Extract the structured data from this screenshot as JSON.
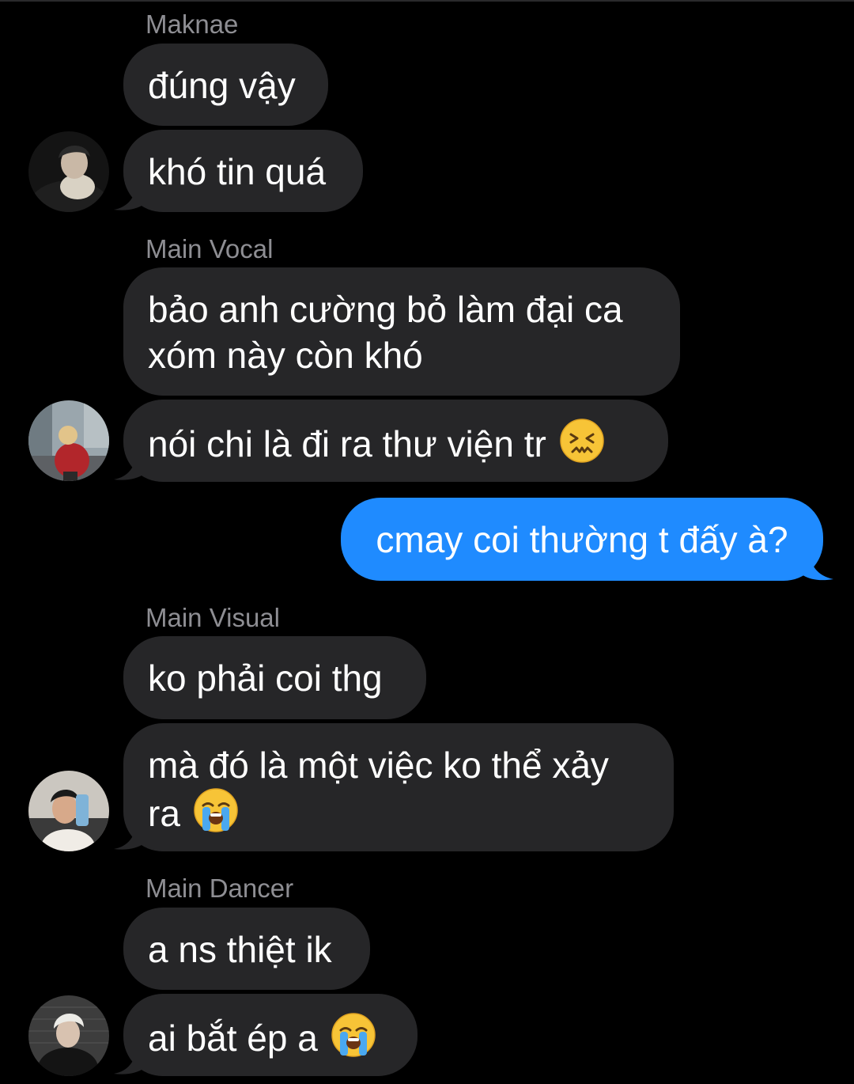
{
  "thread": {
    "groups": [
      {
        "sender": "Maknae",
        "messages": [
          "đúng vậy",
          "khó tin quá"
        ],
        "avatar": "avatar-maknae"
      },
      {
        "sender": "Main Vocal",
        "messages": [
          {
            "line1": "bảo anh cường bỏ làm đại ca",
            "line2": "xóm này còn khó"
          },
          {
            "text": "nói chi là đi ra thư viện tr",
            "emoji": "confounded-face-emoji"
          }
        ],
        "avatar": "avatar-main-vocal"
      },
      {
        "outgoing": "cmay coi thường t đấy à?"
      },
      {
        "sender": "Main Visual",
        "messages": [
          "ko phải coi thg",
          {
            "line1": "mà đó là một việc ko thể xảy",
            "line2": "ra",
            "emoji": "loudly-crying-face-emoji"
          }
        ],
        "avatar": "avatar-main-visual"
      },
      {
        "sender": "Main Dancer",
        "messages": [
          "a ns thiệt ik",
          {
            "text": "ai bắt ép a",
            "emoji": "loudly-crying-face-emoji"
          }
        ],
        "avatar": "avatar-main-dancer"
      }
    ]
  },
  "colors": {
    "background": "#000000",
    "incoming_bubble": "#262628",
    "outgoing_bubble": "#1f8bff",
    "sender_label": "#8e8e93",
    "text": "#ffffff"
  }
}
